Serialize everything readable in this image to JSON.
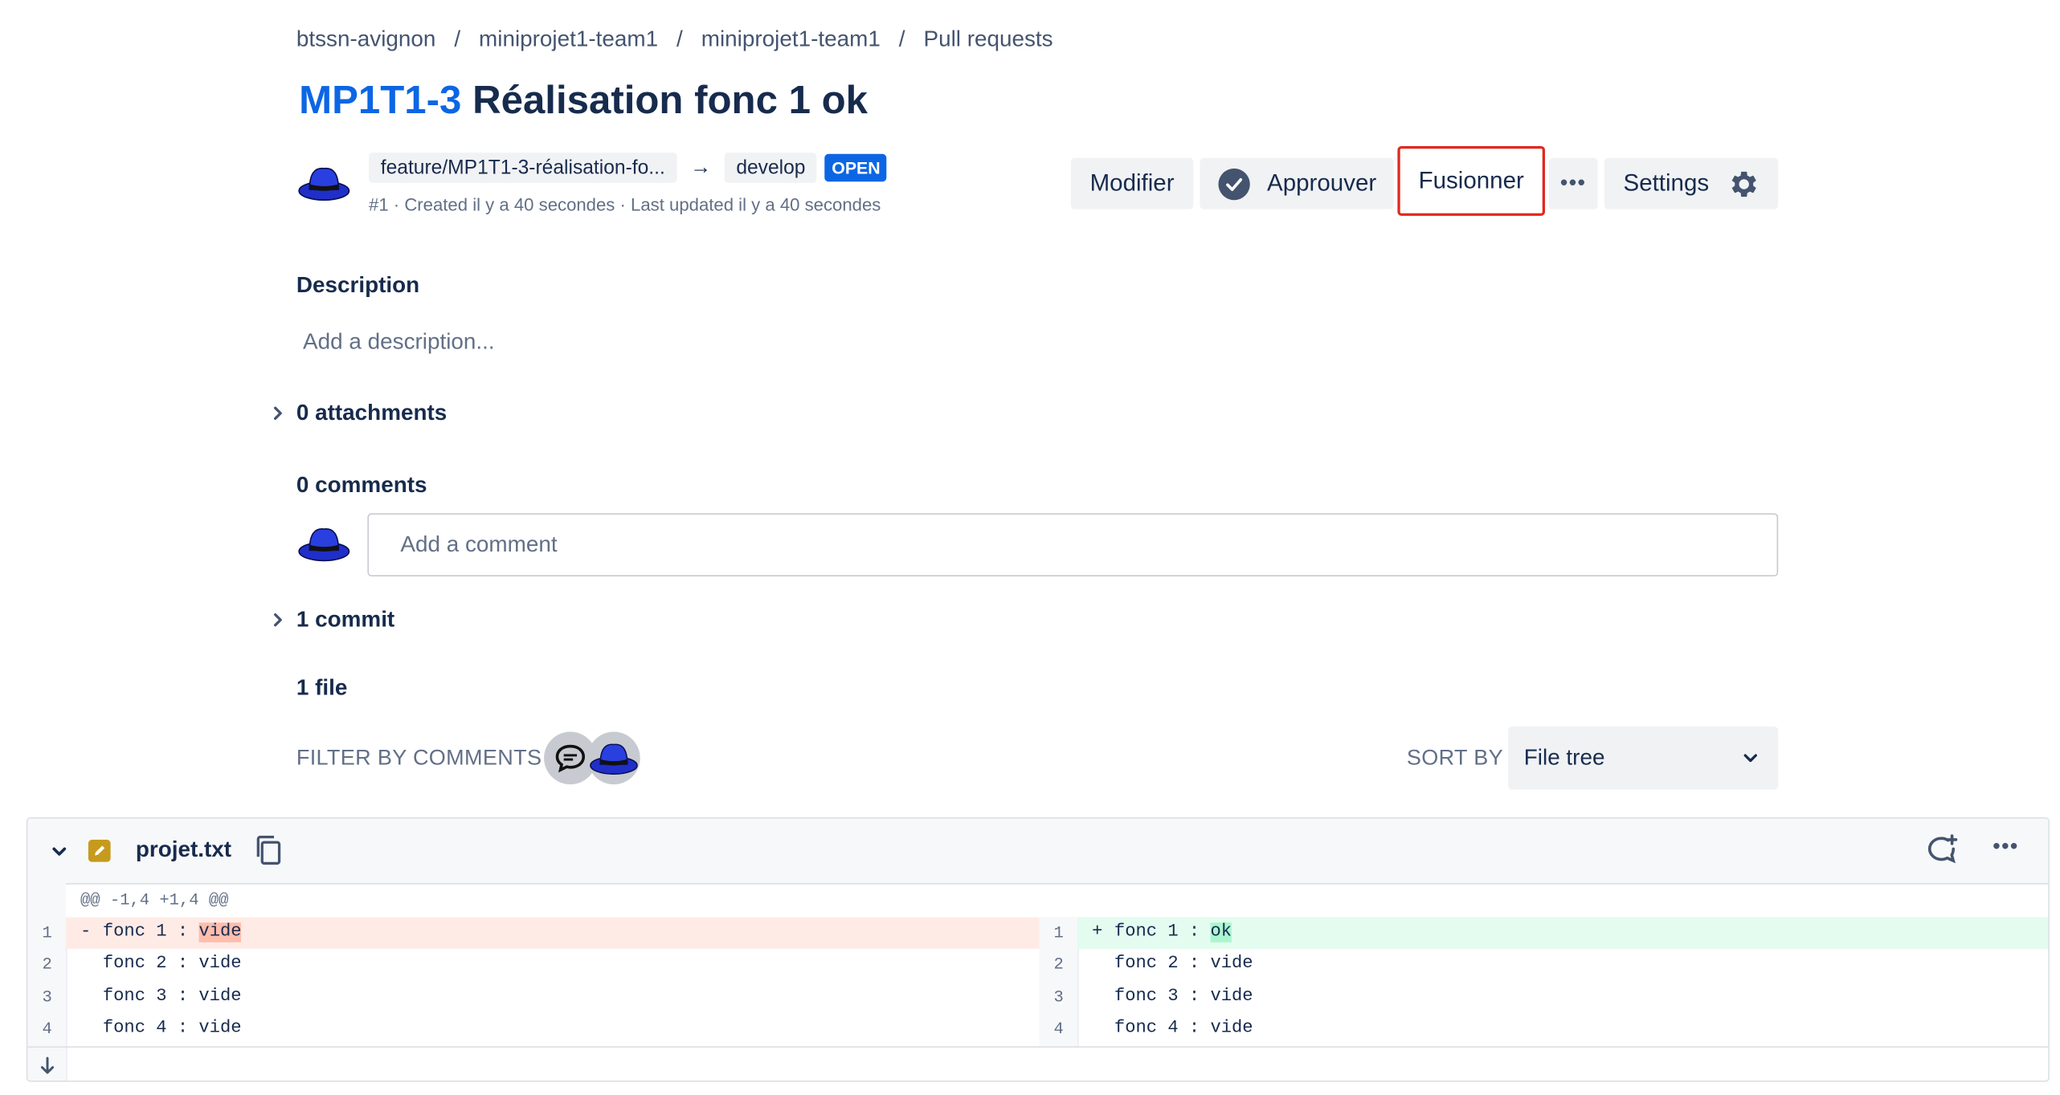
{
  "breadcrumbs": [
    "btssn-avignon",
    "miniprojet1-team1",
    "miniprojet1-team1",
    "Pull requests"
  ],
  "breadcrumb_sep": "/",
  "pr": {
    "key": "MP1T1-3",
    "title": "Réalisation fonc 1 ok",
    "source_branch": "feature/MP1T1-3-réalisation-fo...",
    "arrow": "→",
    "target_branch": "develop",
    "status": "OPEN",
    "meta": "#1 · Created il y a 40 secondes · Last updated il y a 40 secondes"
  },
  "actions": {
    "edit": "Modifier",
    "approve": "Approuver",
    "merge": "Fusionner",
    "more": "•••",
    "settings": "Settings"
  },
  "description": {
    "heading": "Description",
    "placeholder": "Add a description..."
  },
  "attachments": {
    "label": "0 attachments"
  },
  "comments": {
    "label": "0 comments",
    "placeholder": "Add a comment"
  },
  "commits": {
    "label": "1 commit"
  },
  "files": {
    "label": "1 file",
    "filter_label": "FILTER BY COMMENTS",
    "sort_label": "SORT BY",
    "sort_value": "File tree"
  },
  "diff": {
    "filename": "projet.txt",
    "hunk": "@@ -1,4 +1,4 @@",
    "left": [
      {
        "n": "1",
        "sign": "-",
        "prefix": "fonc 1 : ",
        "hl": "vide"
      },
      {
        "n": "2",
        "sign": " ",
        "prefix": "fonc 2 : vide",
        "hl": ""
      },
      {
        "n": "3",
        "sign": " ",
        "prefix": "fonc 3 : vide",
        "hl": ""
      },
      {
        "n": "4",
        "sign": " ",
        "prefix": "fonc 4 : vide",
        "hl": ""
      }
    ],
    "right": [
      {
        "n": "1",
        "sign": "+",
        "prefix": "fonc 1 : ",
        "hl": "ok"
      },
      {
        "n": "2",
        "sign": " ",
        "prefix": "fonc 2 : vide",
        "hl": ""
      },
      {
        "n": "3",
        "sign": " ",
        "prefix": "fonc 3 : vide",
        "hl": ""
      },
      {
        "n": "4",
        "sign": " ",
        "prefix": "fonc 4 : vide",
        "hl": ""
      }
    ]
  },
  "colors": {
    "link_blue": "#0c66e4",
    "status_blue": "#0c66e4",
    "highlight_red_outline": "#e2271f",
    "deleted_line_bg": "#ffebe6",
    "deleted_word_bg": "#ffbdad",
    "added_line_bg": "#e3fcef",
    "added_word_bg": "#abf5d1",
    "modified_file_icon": "#c69a1c"
  },
  "icons": [
    "user-avatar-hat-icon",
    "arrow-right-icon",
    "check-circle-icon",
    "more-icon",
    "gear-icon",
    "chevron-right-icon",
    "comment-filter-icon",
    "chevron-down-icon",
    "edit-file-icon",
    "copy-icon",
    "add-comment-icon",
    "expand-down-icon"
  ]
}
